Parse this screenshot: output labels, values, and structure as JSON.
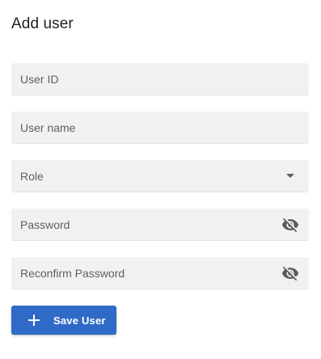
{
  "form": {
    "title": "Add user",
    "fields": [
      {
        "label": "User ID",
        "type": "text",
        "value": ""
      },
      {
        "label": "User name",
        "type": "text",
        "value": ""
      },
      {
        "label": "Role",
        "type": "select",
        "value": ""
      },
      {
        "label": "Password",
        "type": "password",
        "value": "",
        "icon": "visibility-off-icon"
      },
      {
        "label": "Reconfirm Password",
        "type": "password",
        "value": "",
        "icon": "visibility-off-icon"
      }
    ],
    "save_button": {
      "label": "Save User",
      "icon": "plus-icon"
    }
  },
  "colors": {
    "accent": "#2f6bc6",
    "field_bg": "#f1f1f1"
  }
}
